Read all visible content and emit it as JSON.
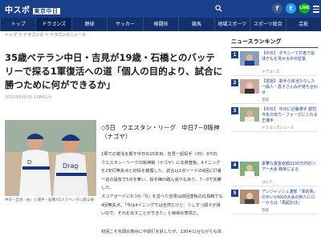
{
  "header": {
    "logo_text": "中スポ",
    "logo_sub": "東京中日",
    "sns": {
      "facebook": "f",
      "twitter": "t",
      "line": "LINE"
    }
  },
  "nav": [
    "トップ",
    "ドラゴンズ",
    "野球",
    "サッカー",
    "格闘技",
    "競馬",
    "地域スポーツ",
    "スポーツ総合",
    "芸能"
  ],
  "breadcrumb": "トップ ＞ ドラゴンズ ＞ ドラゴンズニュース",
  "article": {
    "title": "35歳ベテラン中日・吉見が19歳・石橋とのバッテリーで探る1軍復活への道「個人の目的より、試合に勝つために何ができるか」",
    "date": "2020年6月5日 11時41分",
    "photo_caption": "中日・吉見（右）と捕手・石橋が2人でベンチに座る姿",
    "lead": "◇5日　ウエスタン・リーグ　中日7－0阪神（ナゴヤ）",
    "paragraphs": [
      "1軍での復活を期す中日の15年目、吉見一起投手（35）が5日、ウエスタン・リーグの阪神戦（ナゴヤ）に先発登板。4イニングを2安打無失点と好投を披露した。試合は2点リードの4回に打者一巡の猛攻で5点を奪い、投手陣の踏ん張りもあり、7－0で完勝した。",
      "スコアボードに5つの「0」を並べた吉見は前回登板の広島戦でも4回無失点。「今は4イニングでは全然だけど、少しずつ調子が良いので、それを出すことができた」と納得の表情だ。",
      "初回こそ先頭の熊谷に中前打を許したが、130キロ台ながらも球"
    ]
  },
  "sidebar": {
    "title": "ニュースランキング",
    "items": [
      {
        "rank": "1",
        "text": "【中日】 ダモシーて打者で投球ぎもを見せる中日監督",
        "cat": "ドラゴンズ"
      },
      {
        "rank": "2",
        "text": "【芸能】 歌手ら体当たりした一般人・息子さんみが待ち合わせ",
        "cat": "芸能"
      },
      {
        "rank": "3",
        "text": "【中日】 中日に近藤選手 郡司 今年の体力・フェーズに入れる正捕手",
        "cat": "ドラゴンズニュース"
      },
      {
        "rank": "4",
        "text": "豪華な賞金総額2100万円のツアー大会 戦争による",
        "cat": "ゴルフ"
      },
      {
        "rank": "5",
        "text": "アンジャッシュ渡部「率的責」のせいかNGO大会の新たにローからは「再起おぼ」",
        "cat": "芸能"
      }
    ]
  }
}
